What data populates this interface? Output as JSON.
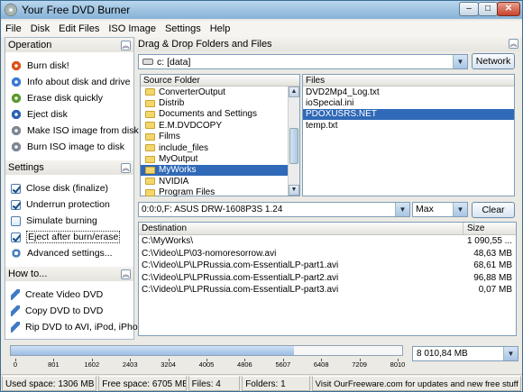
{
  "window": {
    "title": "Your Free DVD Burner",
    "min": "–",
    "max": "□",
    "close": "✕"
  },
  "menu": [
    "File",
    "Disk",
    "Edit Files",
    "ISO Image",
    "Settings",
    "Help"
  ],
  "left": {
    "operation": {
      "title": "Operation",
      "items": [
        {
          "label": "Burn disk!",
          "icon": "burn-disk-icon",
          "color": "#d9541c"
        },
        {
          "label": "Info about disk and drive",
          "icon": "info-icon",
          "color": "#3a7bd5"
        },
        {
          "label": "Erase disk quickly",
          "icon": "erase-icon",
          "color": "#5b9a2e"
        },
        {
          "label": "Eject disk",
          "icon": "eject-icon",
          "color": "#2b63b5"
        },
        {
          "label": "Make ISO image from disk",
          "icon": "make-iso-icon",
          "color": "#7d8794"
        },
        {
          "label": "Burn ISO image to disk",
          "icon": "burn-iso-icon",
          "color": "#7d8794"
        }
      ]
    },
    "settings": {
      "title": "Settings",
      "items": [
        {
          "label": "Close disk (finalize)",
          "checked": true
        },
        {
          "label": "Underrun protection",
          "checked": true
        },
        {
          "label": "Simulate burning",
          "checked": false
        },
        {
          "label": "Eject after burn/erase",
          "checked": true
        }
      ],
      "advanced": "Advanced settings..."
    },
    "howto": {
      "title": "How to...",
      "items": [
        "Create Video DVD",
        "Copy DVD to DVD",
        "Rip DVD to AVI,  iPod, iPhone"
      ]
    }
  },
  "right": {
    "header": "Drag & Drop Folders and Files",
    "drive_value": "c: [data]",
    "network_label": "Network",
    "source_header": "Source Folder",
    "folders": [
      "ConverterOutput",
      "Distrib",
      "Documents and Settings",
      "E.M.DVDCOPY",
      "Films",
      "include_files",
      "MyOutput",
      "MyWorks",
      "NVIDIA",
      "Program Files"
    ],
    "selected_folder": "MyWorks",
    "files_header": "Files",
    "files": [
      "DVD2Mp4_Log.txt",
      "ioSpecial.ini",
      "PDOXUSRS.NET",
      "temp.txt"
    ],
    "selected_file": "PDOXUSRS.NET",
    "device_value": "0:0:0,F: ASUS    DRW-1608P3S     1.24",
    "speed_value": "Max",
    "clear_label": "Clear",
    "dest_headers": {
      "destination": "Destination",
      "size": "Size"
    },
    "dest_rows": [
      {
        "path": "C:\\MyWorks\\",
        "size": "1 090,55 ..."
      },
      {
        "path": "C:\\Video\\LP\\03-nomoresorrow.avi",
        "size": "48,63 MB"
      },
      {
        "path": "C:\\Video\\LP\\LPRussia.com-EssentialLP-part1.avi",
        "size": "68,61 MB"
      },
      {
        "path": "C:\\Video\\LP\\LPRussia.com-EssentialLP-part2.avi",
        "size": "96,88 MB"
      },
      {
        "path": "C:\\Video\\LP\\LPRussia.com-EssentialLP-part3.avi",
        "size": "0,07 MB"
      }
    ]
  },
  "capacity": {
    "ticks": [
      "0",
      "801",
      "1602",
      "2403",
      "3204",
      "4005",
      "4806",
      "5607",
      "6408",
      "7209",
      "8010"
    ],
    "max_value": 8010,
    "used_value": 6705,
    "size_value": "8 010,84 MB"
  },
  "status": [
    "Used space: 1306 MB",
    "Free space: 6705 MB",
    "Files: 4",
    "Folders: 1",
    "Visit OurFreeware.com for updates and new free stuff"
  ]
}
